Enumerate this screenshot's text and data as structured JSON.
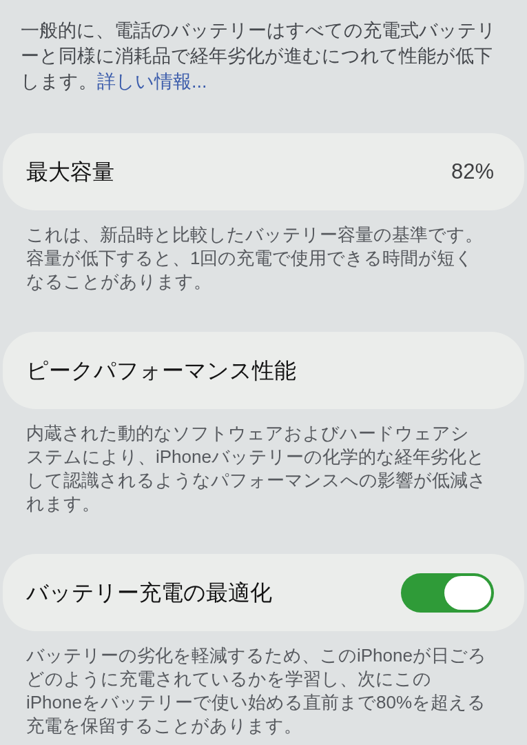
{
  "intro": {
    "text": "一般的に、電話のバッテリーはすべての充電式バッテリーと同様に消耗品で経年劣化が進むにつれて性能が低下します。",
    "link": "詳しい情報..."
  },
  "sections": [
    {
      "kind": "value",
      "title": "最大容量",
      "value": "82%",
      "description": "これは、新品時と比較したバッテリー容量の基準です。容量が低下すると、1回の充電で使用できる時間が短くなることがあります。"
    },
    {
      "kind": "plain",
      "title": "ピークパフォーマンス性能",
      "description": "内蔵された動的なソフトウェアおよびハードウェアシステムにより、iPhoneバッテリーの化学的な経年劣化として認識されるようなパフォーマンスへの影響が低減されます。"
    },
    {
      "kind": "toggle",
      "title": "バッテリー充電の最適化",
      "on": true,
      "description": "バッテリーの劣化を軽減するため、このiPhoneが日ごろどのように充電されているかを学習し、次にこのiPhoneをバッテリーで使い始める直前まで80%を超える充電を保留することがあります。"
    }
  ]
}
